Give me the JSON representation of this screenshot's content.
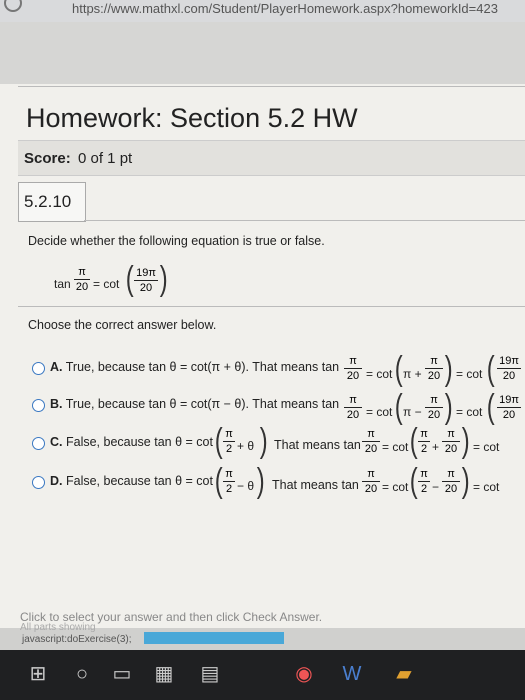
{
  "browser": {
    "url": "https://www.mathxl.com/Student/PlayerHomework.aspx?homeworkId=423"
  },
  "header": {
    "title": "Homework: Section 5.2 HW"
  },
  "score": {
    "label": "Score:",
    "value": "0 of 1 pt"
  },
  "question": {
    "number": "5.2.10",
    "prompt": "Decide whether the following equation is true or false.",
    "equation": {
      "lhs_fn": "tan",
      "lhs_num": "π",
      "lhs_den": "20",
      "eq": "= cot",
      "rhs_num": "19π",
      "rhs_den": "20"
    },
    "instruction": "Choose the correct answer below."
  },
  "options": [
    {
      "letter": "A.",
      "text": "True, because tan θ = cot(π + θ). That means tan",
      "frac1_num": "π",
      "frac1_den": "20",
      "mid": "= cot",
      "inner_pre": "π +",
      "inner_num": "π",
      "inner_den": "20",
      "tail": "= cot",
      "last_num": "19π",
      "last_den": "20"
    },
    {
      "letter": "B.",
      "text": "True, because tan θ = cot(π − θ). That means tan",
      "frac1_num": "π",
      "frac1_den": "20",
      "mid": "= cot",
      "inner_pre": "π −",
      "inner_num": "π",
      "inner_den": "20",
      "tail": "= cot",
      "last_num": "19π",
      "last_den": "20"
    },
    {
      "letter": "C.",
      "text": "False, because tan θ = cot",
      "frac0_num": "π",
      "frac0_den": "2",
      "frac0_tail": "+ θ",
      "text2": "That means tan",
      "frac1_num": "π",
      "frac1_den": "20",
      "mid": "= cot",
      "inner_num": "π",
      "inner_den": "2",
      "inner_op": "+",
      "inner2_num": "π",
      "inner2_den": "20",
      "tail": "= cot"
    },
    {
      "letter": "D.",
      "text": "False, because tan θ = cot",
      "frac0_num": "π",
      "frac0_den": "2",
      "frac0_tail": "− θ",
      "text2": "That means tan",
      "frac1_num": "π",
      "frac1_den": "20",
      "mid": "= cot",
      "inner_num": "π",
      "inner_den": "2",
      "inner_op": "−",
      "inner2_num": "π",
      "inner2_den": "20",
      "tail": "= cot"
    }
  ],
  "footer": {
    "hint": "Click to select your answer and then click Check Answer.",
    "faded": "All parts showing",
    "status_js": "javascript:doExercise(3);"
  },
  "colors": {
    "accent": "#3a78c2",
    "progress": "#4aa8d8"
  }
}
